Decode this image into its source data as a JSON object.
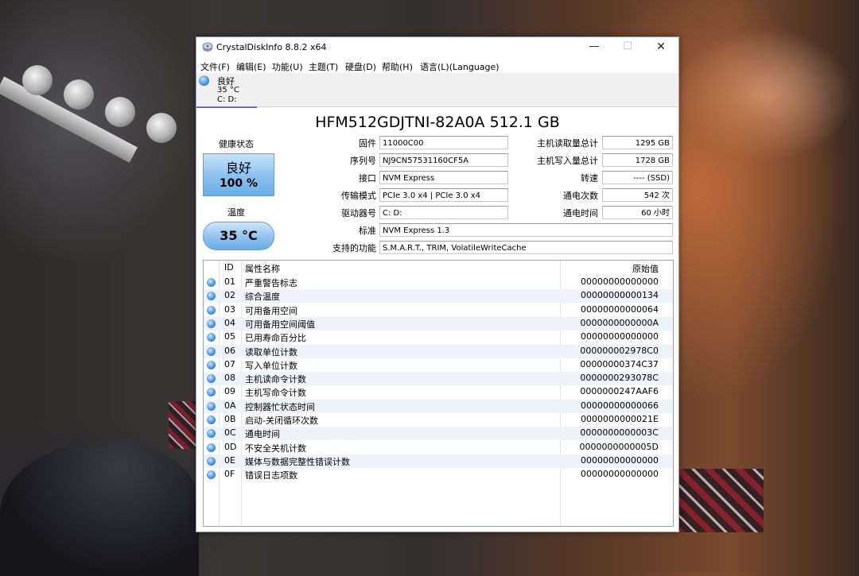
{
  "window": {
    "title": "CrystalDiskInfo 8.8.2 x64"
  },
  "menu": [
    "文件(F)",
    "编辑(E)",
    "功能(U)",
    "主题(T)",
    "硬盘(D)",
    "帮助(H)",
    "语言(L)(Language)"
  ],
  "disk_tab": {
    "status": "良好",
    "temp": "35 °C",
    "letter": "C: D:"
  },
  "model": "HFM512GDJTNI-82A0A 512.1 GB",
  "health": {
    "label": "健康状态",
    "status": "良好",
    "percent": "100 %"
  },
  "temperature": {
    "label": "温度",
    "value": "35 °C"
  },
  "info": {
    "firmware_label": "固件",
    "firmware": "11000C00",
    "serial_label": "序列号",
    "serial": "NJ9CN57531160CF5A",
    "interface_label": "接口",
    "interface": "NVM Express",
    "transfer_label": "传输模式",
    "transfer": "PCIe 3.0 x4 | PCIe 3.0 x4",
    "drive_label": "驱动器号",
    "drive": "C: D:",
    "standard_label": "标准",
    "standard": "NVM Express 1.3",
    "features_label": "支持的功能",
    "features": "S.M.A.R.T., TRIM, VolatileWriteCache",
    "host_reads_label": "主机读取量总计",
    "host_reads": "1295 GB",
    "host_writes_label": "主机写入量总计",
    "host_writes": "1728 GB",
    "rotation_label": "转速",
    "rotation": "---- (SSD)",
    "power_on_count_label": "通电次数",
    "power_on_count": "542 次",
    "power_on_hours_label": "通电时间",
    "power_on_hours": "60 小时"
  },
  "smart": {
    "headers": {
      "id": "ID",
      "name": "属性名称",
      "raw": "原始值"
    },
    "rows": [
      {
        "id": "01",
        "name": "严重警告标志",
        "raw": "00000000000000"
      },
      {
        "id": "02",
        "name": "综合温度",
        "raw": "00000000000134"
      },
      {
        "id": "03",
        "name": "可用备用空间",
        "raw": "00000000000064"
      },
      {
        "id": "04",
        "name": "可用备用空间阈值",
        "raw": "0000000000000A"
      },
      {
        "id": "05",
        "name": "已用寿命百分比",
        "raw": "00000000000000"
      },
      {
        "id": "06",
        "name": "读取单位计数",
        "raw": "000000002978C0"
      },
      {
        "id": "07",
        "name": "写入单位计数",
        "raw": "00000000374C37"
      },
      {
        "id": "08",
        "name": "主机读命令计数",
        "raw": "0000000293078C"
      },
      {
        "id": "09",
        "name": "主机写命令计数",
        "raw": "0000000247AAF6"
      },
      {
        "id": "0A",
        "name": "控制器忙状态时间",
        "raw": "00000000000066"
      },
      {
        "id": "0B",
        "name": "启动-关闭循环次数",
        "raw": "0000000000021E"
      },
      {
        "id": "0C",
        "name": "通电时间",
        "raw": "0000000000003C"
      },
      {
        "id": "0D",
        "name": "不安全关机计数",
        "raw": "0000000000005D"
      },
      {
        "id": "0E",
        "name": "媒体与数据完整性错误计数",
        "raw": "00000000000000"
      },
      {
        "id": "0F",
        "name": "错误日志项数",
        "raw": "00000000000000"
      }
    ]
  }
}
